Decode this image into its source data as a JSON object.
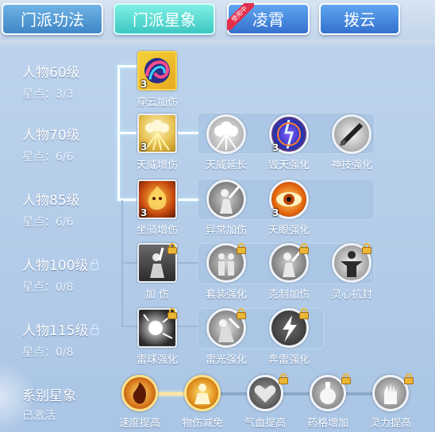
{
  "tabs": [
    {
      "label": "门派功法"
    },
    {
      "label": "门派星象"
    },
    {
      "label": "凌霄",
      "badge": "使用中"
    },
    {
      "label": "拨云"
    }
  ],
  "rows": [
    {
      "level": "人物60级",
      "points": "星点：3/3",
      "locked": false
    },
    {
      "level": "人物70级",
      "points": "星点：6/6",
      "locked": false
    },
    {
      "level": "人物85级",
      "points": "星点：6/6",
      "locked": false
    },
    {
      "level": "人物100级",
      "points": "星点：0/8",
      "locked": true
    },
    {
      "level": "人物115级",
      "points": "星点：0/8",
      "locked": true
    }
  ],
  "skills": {
    "r1": [
      {
        "name": "穿云加伤",
        "level": "3",
        "icon": "cloud-swirl-icon"
      }
    ],
    "r2": [
      {
        "name": "天威增伤",
        "level": "3",
        "icon": "golden-clouds-icon"
      },
      {
        "name": "天威延长",
        "level": "",
        "icon": "white-clouds-icon"
      },
      {
        "name": "毁天强化",
        "level": "3",
        "icon": "lightning-orb-icon"
      },
      {
        "name": "神技强化",
        "level": "",
        "icon": "sword-slash-icon"
      }
    ],
    "r3": [
      {
        "name": "坐骑增伤",
        "level": "3",
        "icon": "fire-beast-icon"
      },
      {
        "name": "异常加伤",
        "level": "",
        "icon": "warrior-strike-icon"
      },
      {
        "name": "天眼强化",
        "level": "3",
        "icon": "fire-eye-icon"
      }
    ],
    "r4": [
      {
        "name": "加 伤",
        "level": "",
        "icon": "sword-raise-icon"
      },
      {
        "name": "套装强化",
        "level": "",
        "icon": "twin-figures-icon"
      },
      {
        "name": "克制加伤",
        "level": "",
        "icon": "warrior-strike-icon"
      },
      {
        "name": "灵心抗封",
        "level": "",
        "icon": "spirit-figure-icon"
      }
    ],
    "r5": [
      {
        "name": "雷球强化",
        "level": "",
        "icon": "thunder-ball-icon"
      },
      {
        "name": "雷光强化",
        "level": "",
        "icon": "thunder-warrior-icon"
      },
      {
        "name": "奔雷强化",
        "level": "",
        "icon": "lightning-bolt-icon"
      }
    ]
  },
  "series": {
    "title": "系别星象",
    "status": "已激活",
    "items": [
      {
        "name": "速度提高",
        "icon": "speed-flame-icon"
      },
      {
        "name": "物伤减免",
        "icon": "flame-person-icon"
      },
      {
        "name": "气血提高",
        "icon": "heart-icon"
      },
      {
        "name": "药格增加",
        "icon": "potion-flask-icon"
      },
      {
        "name": "灵力提高",
        "icon": "palm-light-icon"
      }
    ]
  },
  "colors": {
    "accent_tab": "#3cc7c2",
    "lock_gold": "#e9b637",
    "badge_red": "#e3304c"
  }
}
